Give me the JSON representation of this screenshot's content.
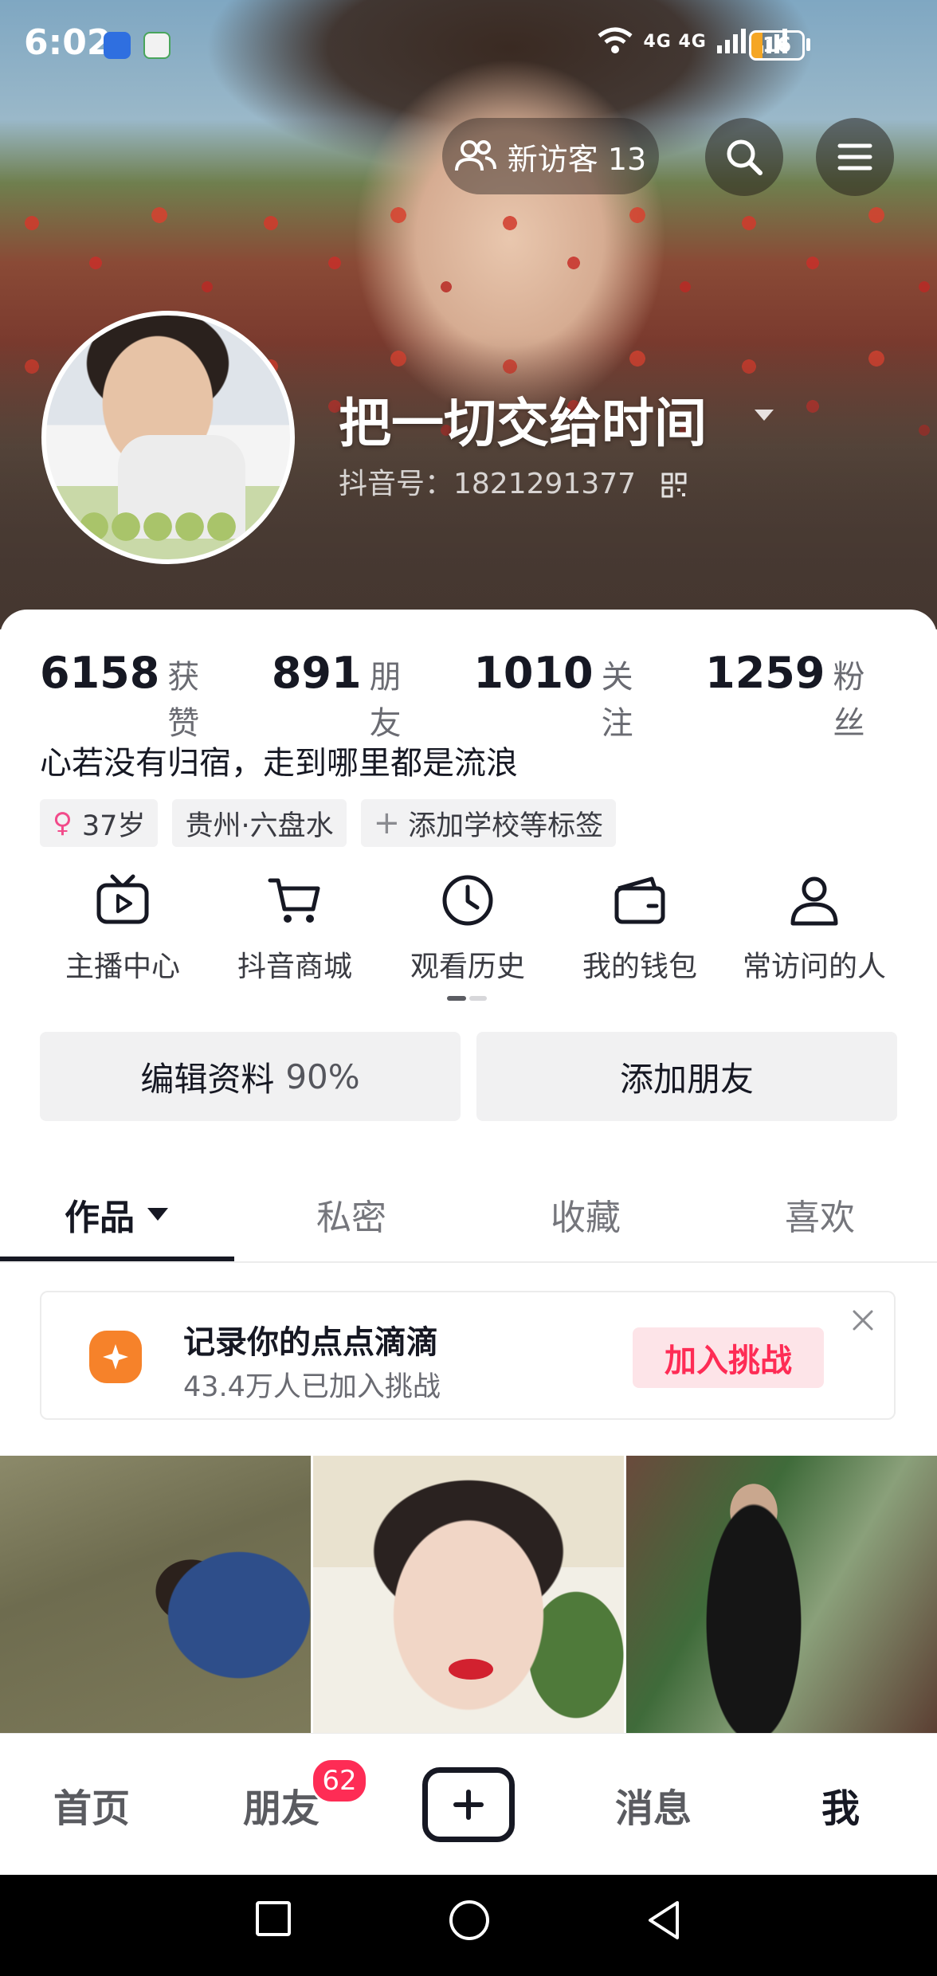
{
  "status_bar": {
    "time": "6:02",
    "signal_text": "4G 4G",
    "battery": "16"
  },
  "header": {
    "visitors_label": "新访客 13",
    "username": "把一切交给时间",
    "douyin_id": "抖音号：1821291377"
  },
  "stats": [
    {
      "num": "6158",
      "label": "获赞"
    },
    {
      "num": "891",
      "label": "朋友"
    },
    {
      "num": "1010",
      "label": "关注"
    },
    {
      "num": "1259",
      "label": "粉丝"
    }
  ],
  "bio": "心若没有归宿，走到哪里都是流浪",
  "tags": {
    "age": "37岁",
    "location": "贵州·六盘水",
    "add": "添加学校等标签"
  },
  "shortcuts": [
    {
      "label": "主播中心",
      "icon": "tv-icon"
    },
    {
      "label": "抖音商城",
      "icon": "cart-icon"
    },
    {
      "label": "观看历史",
      "icon": "clock-icon"
    },
    {
      "label": "我的钱包",
      "icon": "wallet-icon"
    },
    {
      "label": "常访问的人",
      "icon": "person-icon"
    }
  ],
  "buttons": {
    "edit_label": "编辑资料",
    "edit_pct": "90%",
    "add_friend": "添加朋友"
  },
  "tabs": [
    "作品",
    "私密",
    "收藏",
    "喜欢"
  ],
  "banner": {
    "title": "记录你的点点滴滴",
    "subtitle": "43.4万人已加入挑战",
    "join": "加入挑战"
  },
  "bottom_nav": {
    "home": "首页",
    "friends": "朋友",
    "friends_badge": "62",
    "messages": "消息",
    "me": "我"
  },
  "colors": {
    "accent": "#fe2c55",
    "banner_icon": "#f6822a",
    "text": "#161823"
  }
}
